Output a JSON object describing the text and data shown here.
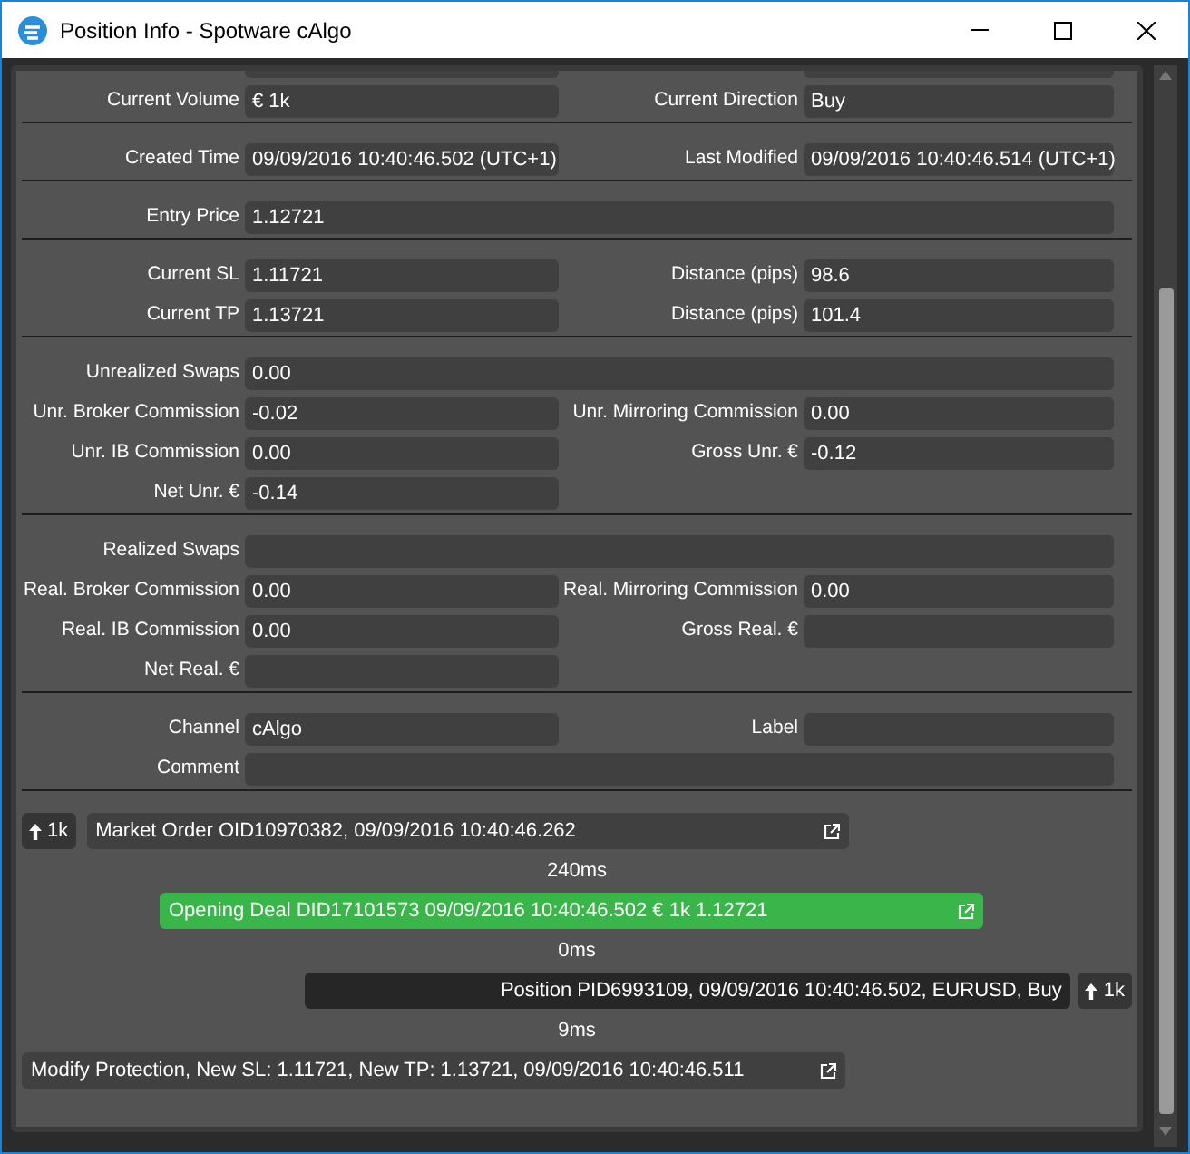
{
  "window": {
    "title": "Position Info - Spotware cAlgo"
  },
  "sections": [
    {
      "rows": [
        {
          "kind": "clipped"
        },
        {
          "kind": "pair",
          "fields": [
            {
              "label": "Current Volume",
              "value": "€ 1k"
            },
            {
              "label": "Current Direction",
              "value": "Buy"
            }
          ]
        }
      ]
    },
    {
      "rows": [
        {
          "kind": "pair",
          "fields": [
            {
              "label": "Created Time",
              "value": "09/09/2016 10:40:46.502 (UTC+1)"
            },
            {
              "label": "Last Modified",
              "value": "09/09/2016 10:40:46.514 (UTC+1)"
            }
          ]
        }
      ]
    },
    {
      "rows": [
        {
          "kind": "full",
          "fields": [
            {
              "label": "Entry Price",
              "value": "1.12721"
            }
          ]
        }
      ]
    },
    {
      "rows": [
        {
          "kind": "pair",
          "fields": [
            {
              "label": "Current SL",
              "value": "1.11721"
            },
            {
              "label": "Distance (pips)",
              "value": "98.6"
            }
          ]
        },
        {
          "kind": "pair",
          "fields": [
            {
              "label": "Current TP",
              "value": "1.13721"
            },
            {
              "label": "Distance (pips)",
              "value": "101.4"
            }
          ]
        }
      ]
    },
    {
      "rows": [
        {
          "kind": "full",
          "fields": [
            {
              "label": "Unrealized Swaps",
              "value": "0.00"
            }
          ]
        },
        {
          "kind": "pair",
          "fields": [
            {
              "label": "Unr. Broker Commission",
              "value": "-0.02"
            },
            {
              "label": "Unr. Mirroring Commission",
              "value": "0.00"
            }
          ]
        },
        {
          "kind": "pair",
          "fields": [
            {
              "label": "Unr. IB Commission",
              "value": "0.00"
            },
            {
              "label": "Gross Unr. €",
              "value": "-0.12"
            }
          ]
        },
        {
          "kind": "single",
          "fields": [
            {
              "label": "Net Unr. €",
              "value": "-0.14"
            }
          ]
        }
      ]
    },
    {
      "rows": [
        {
          "kind": "full",
          "fields": [
            {
              "label": "Realized Swaps"
            }
          ]
        },
        {
          "kind": "pair",
          "fields": [
            {
              "label": "Real. Broker Commission",
              "value": "0.00"
            },
            {
              "label": "Real. Mirroring Commission",
              "value": "0.00"
            }
          ]
        },
        {
          "kind": "pair",
          "fields": [
            {
              "label": "Real. IB Commission",
              "value": "0.00"
            },
            {
              "label": "Gross Real. €"
            }
          ]
        },
        {
          "kind": "single",
          "fields": [
            {
              "label": "Net Real. €"
            }
          ]
        }
      ]
    },
    {
      "rows": [
        {
          "kind": "pair",
          "fields": [
            {
              "label": "Channel",
              "value": "cAlgo"
            },
            {
              "label": "Label"
            }
          ]
        },
        {
          "kind": "full",
          "fields": [
            {
              "label": "Comment"
            }
          ]
        }
      ]
    }
  ],
  "timeline": [
    {
      "kind": "order",
      "badge": "1k",
      "text": "Market Order OID10970382, 09/09/2016 10:40:46.262"
    },
    {
      "kind": "gap",
      "text": "240ms"
    },
    {
      "kind": "deal",
      "text": "Opening Deal DID17101573 09/09/2016 10:40:46.502 € 1k 1.12721"
    },
    {
      "kind": "gap",
      "text": "0ms"
    },
    {
      "kind": "position",
      "badge": "1k",
      "text": "Position PID6993109, 09/09/2016 10:40:46.502, EURUSD, Buy"
    },
    {
      "kind": "gap",
      "text": "9ms"
    },
    {
      "kind": "modify",
      "text": "Modify Protection, New SL: 1.11721, New TP: 1.13721, 09/09/2016 10:40:46.511"
    }
  ]
}
